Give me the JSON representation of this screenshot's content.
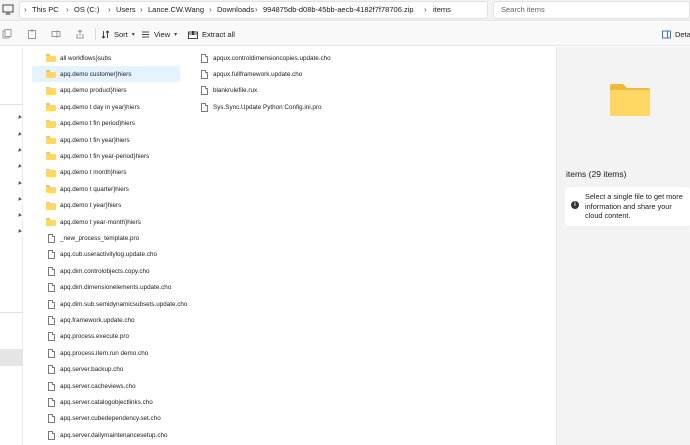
{
  "breadcrumb": [
    "This PC",
    "OS (C:)",
    "Users",
    "Lance.CW.Wang",
    "Downloads",
    "994875db-d08b-45bb-aecb-4182f7f78706.zip",
    "items"
  ],
  "search": {
    "placeholder": "Search items"
  },
  "toolbar": {
    "sort_label": "Sort",
    "view_label": "View",
    "extract_label": "Extract all",
    "details_label": "Detail"
  },
  "files_col1": [
    {
      "name": "all workflows}subs",
      "type": "folder"
    },
    {
      "name": "apq.demo customer}hiers",
      "type": "folder",
      "selected": true
    },
    {
      "name": "apq.demo product}hiers",
      "type": "folder"
    },
    {
      "name": "apq.demo t day in year}hiers",
      "type": "folder"
    },
    {
      "name": "apq.demo t fin period}hiers",
      "type": "folder"
    },
    {
      "name": "apq.demo t fin year}hiers",
      "type": "folder"
    },
    {
      "name": "apq.demo t fin year-period}hiers",
      "type": "folder"
    },
    {
      "name": "apq.demo t month}hiers",
      "type": "folder"
    },
    {
      "name": "apq.demo t quarter}hiers",
      "type": "folder"
    },
    {
      "name": "apq.demo t year}hiers",
      "type": "folder"
    },
    {
      "name": "apq.demo t year-month}hiers",
      "type": "folder"
    },
    {
      "name": "_new_process_template.pro",
      "type": "file"
    },
    {
      "name": "apq.cub.useractivitylog.update.cho",
      "type": "file"
    },
    {
      "name": "apq.dim.controlobjects.copy.cho",
      "type": "file"
    },
    {
      "name": "apq.dim.dimensionelements.update.cho",
      "type": "file"
    },
    {
      "name": "apq.dim.sub.semidynamicsubsets.update.cho",
      "type": "file"
    },
    {
      "name": "apq.framework.update.cho",
      "type": "file"
    },
    {
      "name": "apq.process.execute.pro",
      "type": "file"
    },
    {
      "name": "apq.process.item.run demo.cho",
      "type": "file"
    },
    {
      "name": "apq.server.backup.cho",
      "type": "file"
    },
    {
      "name": "apq.server.cacheviews.cho",
      "type": "file"
    },
    {
      "name": "apq.server.catalogobjectlinks.cho",
      "type": "file"
    },
    {
      "name": "apq.server.cubedependency.set.cho",
      "type": "file"
    },
    {
      "name": "apq.server.dailymaintenancesetup.cho",
      "type": "file"
    }
  ],
  "files_col2": [
    {
      "name": "apqux.controldimensioncopies.update.cho",
      "type": "file"
    },
    {
      "name": "apqux.fullframework.update.cho",
      "type": "file"
    },
    {
      "name": "blankrulefile.rux",
      "type": "file"
    },
    {
      "name": "Sys.Sync.Update Python Config.ini.pro",
      "type": "file"
    }
  ],
  "details": {
    "title": "items (29 items)",
    "info": "Select a single file to get more information and share your cloud content."
  },
  "colors": {
    "folder": "#ffd764",
    "selection": "#e5f3ff",
    "details_bg": "#f3f3f3"
  }
}
